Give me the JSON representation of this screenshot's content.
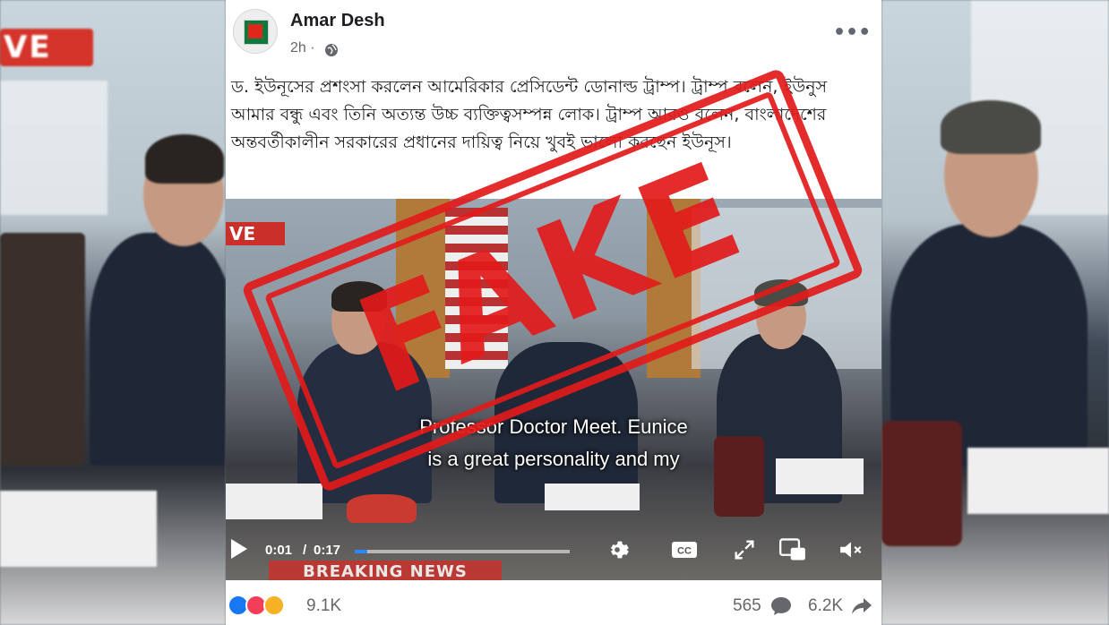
{
  "post": {
    "page_name": "Amar Desh",
    "time": "2h ·",
    "more_label": "•••",
    "text": "ড. ইউনূসের প্রশংসা করলেন আমেরিকার প্রেসিডেন্ট ডোনাল্ড ট্রাম্প। ট্রাম্প বলেন, ইউনুস আমার বন্ধু এবং তিনি অত্যন্ত উচ্চ ব্যক্তিত্বসম্পন্ন লোক। ট্রাম্প আরও বলেন, বাংলাদেশের অন্তবর্তীকালীন সরকারের প্রধানের দায়িত্ব নিয়ে খুবই ভালো করছেন ইউনূস।"
  },
  "video": {
    "live_badge": "VE",
    "subtitle_line1": "Professor Doctor Meet. Eunice",
    "subtitle_line2": "is a great personality and my",
    "time_current": "0:01",
    "time_separator": "/",
    "time_total": "0:17",
    "progress_fraction": 0.06,
    "breaking_news": "BREAKING NEWS",
    "accent_color": "#2d88ff"
  },
  "footer": {
    "reactions_count": "9.1K",
    "comments_count": "565",
    "shares_count": "6.2K"
  },
  "background": {
    "live_badge": "VE"
  },
  "stamp": {
    "text": "FAKE",
    "color": "#e21a1a"
  }
}
